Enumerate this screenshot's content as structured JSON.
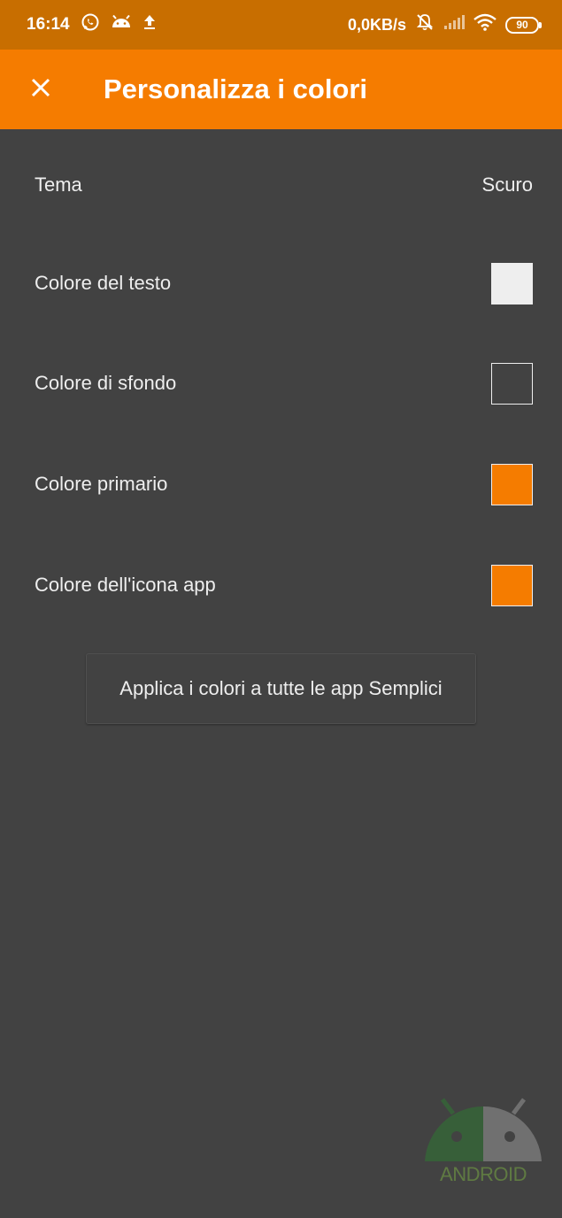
{
  "status_bar": {
    "time": "16:14",
    "net_speed": "0,0KB/s",
    "battery": "90",
    "icons": [
      "whatsapp-icon",
      "android-icon",
      "upload-icon",
      "bell-off-icon",
      "signal-icon",
      "wifi-icon",
      "battery-icon"
    ]
  },
  "toolbar": {
    "close_icon": "close-icon",
    "title": "Personalizza i colori",
    "background": "#F57C00"
  },
  "settings": {
    "theme": {
      "label": "Tema",
      "value": "Scuro"
    },
    "text_color": {
      "label": "Colore del testo",
      "color": "#EEEEEE"
    },
    "background_color": {
      "label": "Colore di sfondo",
      "color": "#424242"
    },
    "primary_color": {
      "label": "Colore primario",
      "color": "#F57C00"
    },
    "app_icon_color": {
      "label": "Colore dell'icona app",
      "color": "#F57C00"
    }
  },
  "apply_button": {
    "label": "Applica i colori a tutte le app Semplici"
  },
  "watermark": {
    "text": "ANDROID"
  }
}
